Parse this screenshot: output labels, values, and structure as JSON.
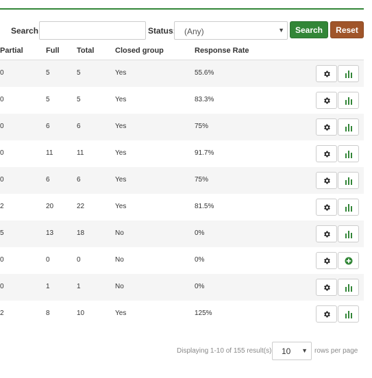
{
  "filter": {
    "search_label": "Search:",
    "search_value": "",
    "status_label": "Status:",
    "status_value": "(Any)",
    "search_button": "Search",
    "reset_button": "Reset"
  },
  "colors": {
    "accent_green": "#328637",
    "reset_brown": "#a0552a"
  },
  "table": {
    "columns": [
      "Partial",
      "Full",
      "Total",
      "Closed group",
      "Response Rate"
    ],
    "rows": [
      {
        "partial": "0",
        "full": "5",
        "total": "5",
        "closed": "Yes",
        "rate": "55.6%",
        "actions": [
          "gear-icon",
          "bar-chart-icon"
        ]
      },
      {
        "partial": "0",
        "full": "5",
        "total": "5",
        "closed": "Yes",
        "rate": "83.3%",
        "actions": [
          "gear-icon",
          "bar-chart-icon"
        ]
      },
      {
        "partial": "0",
        "full": "6",
        "total": "6",
        "closed": "Yes",
        "rate": "75%",
        "actions": [
          "gear-icon",
          "bar-chart-icon"
        ]
      },
      {
        "partial": "0",
        "full": "11",
        "total": "11",
        "closed": "Yes",
        "rate": "91.7%",
        "actions": [
          "gear-icon",
          "bar-chart-icon"
        ]
      },
      {
        "partial": "0",
        "full": "6",
        "total": "6",
        "closed": "Yes",
        "rate": "75%",
        "actions": [
          "gear-icon",
          "bar-chart-icon"
        ]
      },
      {
        "partial": "2",
        "full": "20",
        "total": "22",
        "closed": "Yes",
        "rate": "81.5%",
        "actions": [
          "gear-icon",
          "bar-chart-icon"
        ]
      },
      {
        "partial": "5",
        "full": "13",
        "total": "18",
        "closed": "No",
        "rate": "0%",
        "actions": [
          "gear-icon",
          "bar-chart-icon"
        ]
      },
      {
        "partial": "0",
        "full": "0",
        "total": "0",
        "closed": "No",
        "rate": "0%",
        "actions": [
          "gear-icon",
          "plus-circle-icon"
        ]
      },
      {
        "partial": "0",
        "full": "1",
        "total": "1",
        "closed": "No",
        "rate": "0%",
        "actions": [
          "gear-icon",
          "bar-chart-icon"
        ]
      },
      {
        "partial": "2",
        "full": "8",
        "total": "10",
        "closed": "Yes",
        "rate": "125%",
        "actions": [
          "gear-icon",
          "bar-chart-icon"
        ]
      }
    ]
  },
  "pager": {
    "summary": "Displaying 1-10 of 155 result(s).",
    "rows_value": "10",
    "suffix": "rows per page"
  }
}
